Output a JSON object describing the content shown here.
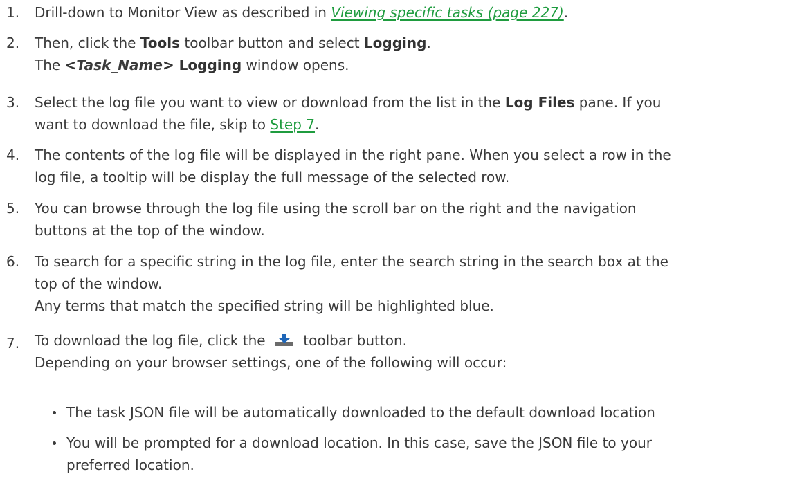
{
  "steps": [
    {
      "num": "1.",
      "pre": "Drill-down to Monitor View as described in ",
      "link": "Viewing specific tasks (page 227)",
      "post": "."
    },
    {
      "num": "2.",
      "pre": "Then, click the ",
      "bold1": "Tools",
      "mid": " toolbar button and select ",
      "bold2": "Logging",
      "post": ".",
      "extra_open": "<",
      "extra_italic": "Task_Name",
      "extra_close": "> Logging",
      "extra_pre": "The ",
      "extra_post": " window opens."
    },
    {
      "num": "3.",
      "pre": "Select the log file you want to view or download from the list in the ",
      "bold": "Log Files",
      "post": " pane. If you",
      "line2_pre": "want to download the file, skip to ",
      "link": "Step 7",
      "line2_post": "."
    },
    {
      "num": "4.",
      "line1": "The contents of the log file will be displayed in the right pane. When you select a row in the",
      "line2": "log file, a tooltip will be display the full message of the selected row."
    },
    {
      "num": "5.",
      "line1": "You can browse through the log file using the scroll bar on the right and the navigation",
      "line2": "buttons at the top of the window."
    },
    {
      "num": "6.",
      "line1": "To search for a specific string in the log file, enter the search string in the search box at the",
      "line2": "top of the window.",
      "extra": "Any terms that match the specified string will be highlighted blue."
    },
    {
      "num": "7.",
      "pre": "To download the log file, click the ",
      "icon": "download-icon",
      "post": " toolbar button.",
      "extra": "Depending on your browser settings, one of the following will occur:",
      "bullets": [
        {
          "line1": "The task JSON file will be automatically downloaded to the default download location"
        },
        {
          "line1": "You will be prompted for a download location. In this case, save the JSON file to your",
          "line2": "preferred location."
        }
      ]
    }
  ],
  "colors": {
    "text": "#3a3a3a",
    "link": "#1f9c3f",
    "icon_tray": "#6b6b6b",
    "icon_arrow": "#1e66b8"
  }
}
